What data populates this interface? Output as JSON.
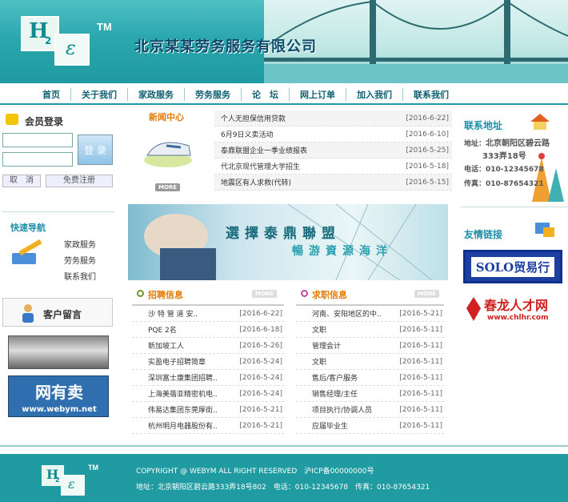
{
  "header": {
    "logo_h": "H",
    "logo_sub": "2",
    "logo_e": "ε",
    "tm": "TM",
    "company": "北京某某劳务服务有限公司"
  },
  "nav": [
    "首页",
    "关于我们",
    "家政服务",
    "劳务服务",
    "论　坛",
    "网上订单",
    "加入我们",
    "联系我们"
  ],
  "login": {
    "title": "会员登录",
    "login_button": "登 录",
    "cancel_button": "取　消",
    "register_button": "免费注册"
  },
  "quicknav": {
    "title": "快速导航",
    "items": [
      "家政服务",
      "劳务服务",
      "联系我们"
    ]
  },
  "message": {
    "title": "客户留言"
  },
  "ads": {
    "webym_title": "网有卖",
    "webym_url": "www.webym.net"
  },
  "news": {
    "title": "新闻中心",
    "more": "MORE",
    "items": [
      {
        "t": "个人无担保信用贷款",
        "d": "[2016-6-22]"
      },
      {
        "t": "6月9日义卖活动",
        "d": "[2016-6-10]"
      },
      {
        "t": "泰鼎联盟企业一季业绩报表",
        "d": "[2016-5-25]"
      },
      {
        "t": "代北京现代管理大学招生",
        "d": "[2016-5-18]"
      },
      {
        "t": "地震区有人求救(代转)",
        "d": "[2016-5-15]"
      }
    ]
  },
  "banner": {
    "line1": "選擇泰鼎聯盟",
    "line2": "暢游資源海洋"
  },
  "jobs": {
    "title": "招聘信息",
    "more": "MORE",
    "items": [
      {
        "t": "沙 特 管 道 安..",
        "d": "[2016-6-22]"
      },
      {
        "t": "PQE 2名",
        "d": "[2016-6-18]"
      },
      {
        "t": "新加坡工人",
        "d": "[2016-5-26]"
      },
      {
        "t": "实盈电子招聘简章",
        "d": "[2016-5-24]"
      },
      {
        "t": "深圳富士康集团招聘..",
        "d": "[2016-5-24]"
      },
      {
        "t": "上海美蓓亚精密机电..",
        "d": "[2016-5-24]"
      },
      {
        "t": "伟易达集团东莞厚街..",
        "d": "[2016-5-21]"
      },
      {
        "t": "杭州明月电器股份有..",
        "d": "[2016-5-21]"
      }
    ]
  },
  "seek": {
    "title": "求职信息",
    "more": "MORE",
    "items": [
      {
        "t": "河南、安阳地区的中..",
        "d": "[2016-5-21]"
      },
      {
        "t": "文职",
        "d": "[2016-5-11]"
      },
      {
        "t": "管理会计",
        "d": "[2016-5-11]"
      },
      {
        "t": "文职",
        "d": "[2016-5-11]"
      },
      {
        "t": "售后/客户服务",
        "d": "[2016-5-11]"
      },
      {
        "t": "销售经理/主任",
        "d": "[2016-5-11]"
      },
      {
        "t": "项目执行/协调人员",
        "d": "[2016-5-11]"
      },
      {
        "t": "应届毕业生",
        "d": "[2016-5-11]"
      }
    ]
  },
  "contact": {
    "title": "联系地址",
    "addr_label": "地址：",
    "addr1": "北京朝阳区碧云路",
    "addr2": "333弄18号",
    "phone": "电话：010-12345678",
    "fax": "传真：010-87654321"
  },
  "links": {
    "title": "友情链接",
    "solo": "SOLO贸易行",
    "chlr": "春龙人才网",
    "chlr_url": "www.chlhr.com"
  },
  "footer": {
    "logo_h": "H",
    "logo_sub": "2",
    "logo_e": "ε",
    "tm": "TM",
    "copyright": "COPYRIGHT @ WEBYM ALL RIGHT RESERVED　沪ICP备00000000号",
    "address": "地址：北京朝阳区碧云路333弄18号802　电话：010-12345678　传真：010-87654321"
  }
}
